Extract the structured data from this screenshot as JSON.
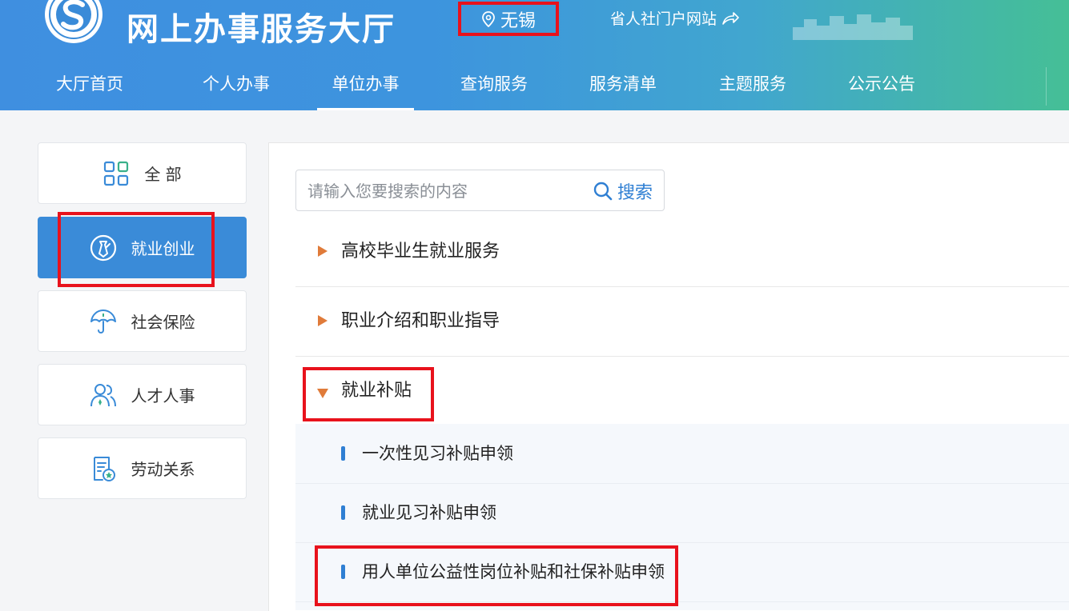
{
  "header": {
    "title": "网上办事服务大厅",
    "city": "无锡",
    "portal_link": "省人社门户网站",
    "icons": [
      "logo",
      "location-pin-icon",
      "share-arrow-icon"
    ],
    "colors": {
      "gradient_start": "#3f8fe0",
      "gradient_end": "#45bf96",
      "highlight": "#e8121c"
    }
  },
  "nav": {
    "items": [
      {
        "label": "大厅首页"
      },
      {
        "label": "个人办事"
      },
      {
        "label": "单位办事",
        "active": true
      },
      {
        "label": "查询服务"
      },
      {
        "label": "服务清单"
      },
      {
        "label": "主题服务"
      },
      {
        "label": "公示公告"
      }
    ]
  },
  "sidebar": {
    "items": [
      {
        "label": "全 部",
        "icon": "grid-icon"
      },
      {
        "label": "就业创业",
        "icon": "employment-tie-icon",
        "active": true
      },
      {
        "label": "社会保险",
        "icon": "umbrella-icon"
      },
      {
        "label": "人才人事",
        "icon": "people-icon"
      },
      {
        "label": "劳动关系",
        "icon": "contract-icon"
      }
    ]
  },
  "search": {
    "placeholder": "请输入您要搜索的内容",
    "button_label": "搜索"
  },
  "categories": [
    {
      "label": "高校毕业生就业服务",
      "expanded": false
    },
    {
      "label": "职业介绍和职业指导",
      "expanded": false
    },
    {
      "label": "就业补贴",
      "expanded": true
    }
  ],
  "subitems": [
    {
      "label": "一次性见习补贴申领"
    },
    {
      "label": "就业见习补贴申领"
    },
    {
      "label": "用人单位公益性岗位补贴和社保补贴申领"
    }
  ]
}
